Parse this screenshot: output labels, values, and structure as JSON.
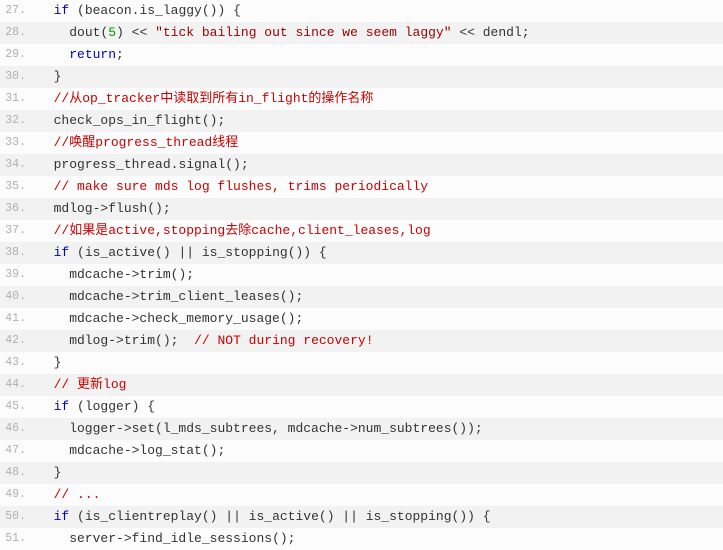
{
  "lines": [
    {
      "n": 27,
      "tokens": [
        {
          "t": "  ",
          "c": ""
        },
        {
          "t": "if",
          "c": "kw"
        },
        {
          "t": " (beacon.",
          "c": ""
        },
        {
          "t": "is_laggy",
          "c": "fn"
        },
        {
          "t": "()) {",
          "c": ""
        }
      ]
    },
    {
      "n": 28,
      "tokens": [
        {
          "t": "    ",
          "c": ""
        },
        {
          "t": "dout",
          "c": "fn"
        },
        {
          "t": "(",
          "c": ""
        },
        {
          "t": "5",
          "c": "num"
        },
        {
          "t": ") << ",
          "c": ""
        },
        {
          "t": "\"tick bailing out since we seem laggy\"",
          "c": "str"
        },
        {
          "t": " << dendl;",
          "c": ""
        }
      ]
    },
    {
      "n": 29,
      "tokens": [
        {
          "t": "    ",
          "c": ""
        },
        {
          "t": "return",
          "c": "kw"
        },
        {
          "t": ";",
          "c": ""
        }
      ]
    },
    {
      "n": 30,
      "tokens": [
        {
          "t": "  }",
          "c": ""
        }
      ]
    },
    {
      "n": 31,
      "tokens": [
        {
          "t": "  ",
          "c": ""
        },
        {
          "t": "//从op_tracker中读取到所有in_flight的操作名称",
          "c": "cmt"
        }
      ]
    },
    {
      "n": 32,
      "tokens": [
        {
          "t": "  ",
          "c": ""
        },
        {
          "t": "check_ops_in_flight",
          "c": "fn"
        },
        {
          "t": "();",
          "c": ""
        }
      ]
    },
    {
      "n": 33,
      "tokens": [
        {
          "t": "  ",
          "c": ""
        },
        {
          "t": "//唤醒progress_thread线程",
          "c": "cmt"
        }
      ]
    },
    {
      "n": 34,
      "tokens": [
        {
          "t": "  progress_thread.",
          "c": ""
        },
        {
          "t": "signal",
          "c": "fn"
        },
        {
          "t": "();",
          "c": ""
        }
      ]
    },
    {
      "n": 35,
      "tokens": [
        {
          "t": "  ",
          "c": ""
        },
        {
          "t": "// make sure mds log flushes, trims periodically",
          "c": "cmt"
        }
      ]
    },
    {
      "n": 36,
      "tokens": [
        {
          "t": "  mdlog->",
          "c": ""
        },
        {
          "t": "flush",
          "c": "fn"
        },
        {
          "t": "();",
          "c": ""
        }
      ]
    },
    {
      "n": 37,
      "tokens": [
        {
          "t": "  ",
          "c": ""
        },
        {
          "t": "//如果是active,stopping去除cache,client_leases,log",
          "c": "cmt"
        }
      ]
    },
    {
      "n": 38,
      "tokens": [
        {
          "t": "  ",
          "c": ""
        },
        {
          "t": "if",
          "c": "kw"
        },
        {
          "t": " (",
          "c": ""
        },
        {
          "t": "is_active",
          "c": "fn"
        },
        {
          "t": "() || ",
          "c": ""
        },
        {
          "t": "is_stopping",
          "c": "fn"
        },
        {
          "t": "()) {",
          "c": ""
        }
      ]
    },
    {
      "n": 39,
      "tokens": [
        {
          "t": "    mdcache->",
          "c": ""
        },
        {
          "t": "trim",
          "c": "fn"
        },
        {
          "t": "();",
          "c": ""
        }
      ]
    },
    {
      "n": 40,
      "tokens": [
        {
          "t": "    mdcache->",
          "c": ""
        },
        {
          "t": "trim_client_leases",
          "c": "fn"
        },
        {
          "t": "();",
          "c": ""
        }
      ]
    },
    {
      "n": 41,
      "tokens": [
        {
          "t": "    mdcache->",
          "c": ""
        },
        {
          "t": "check_memory_usage",
          "c": "fn"
        },
        {
          "t": "();",
          "c": ""
        }
      ]
    },
    {
      "n": 42,
      "tokens": [
        {
          "t": "    mdlog->",
          "c": ""
        },
        {
          "t": "trim",
          "c": "fn"
        },
        {
          "t": "();  ",
          "c": ""
        },
        {
          "t": "// NOT during recovery!",
          "c": "cmt"
        }
      ]
    },
    {
      "n": 43,
      "tokens": [
        {
          "t": "  }",
          "c": ""
        }
      ]
    },
    {
      "n": 44,
      "tokens": [
        {
          "t": "  ",
          "c": ""
        },
        {
          "t": "// 更新log",
          "c": "cmt"
        }
      ]
    },
    {
      "n": 45,
      "tokens": [
        {
          "t": "  ",
          "c": ""
        },
        {
          "t": "if",
          "c": "kw"
        },
        {
          "t": " (logger) {",
          "c": ""
        }
      ]
    },
    {
      "n": 46,
      "tokens": [
        {
          "t": "    logger->",
          "c": ""
        },
        {
          "t": "set",
          "c": "fn"
        },
        {
          "t": "(l_mds_subtrees, mdcache->",
          "c": ""
        },
        {
          "t": "num_subtrees",
          "c": "fn"
        },
        {
          "t": "());",
          "c": ""
        }
      ]
    },
    {
      "n": 47,
      "tokens": [
        {
          "t": "    mdcache->",
          "c": ""
        },
        {
          "t": "log_stat",
          "c": "fn"
        },
        {
          "t": "();",
          "c": ""
        }
      ]
    },
    {
      "n": 48,
      "tokens": [
        {
          "t": "  }",
          "c": ""
        }
      ]
    },
    {
      "n": 49,
      "tokens": [
        {
          "t": "  ",
          "c": ""
        },
        {
          "t": "// ...",
          "c": "cmt"
        }
      ]
    },
    {
      "n": 50,
      "tokens": [
        {
          "t": "  ",
          "c": ""
        },
        {
          "t": "if",
          "c": "kw"
        },
        {
          "t": " (",
          "c": ""
        },
        {
          "t": "is_clientreplay",
          "c": "fn"
        },
        {
          "t": "() || ",
          "c": ""
        },
        {
          "t": "is_active",
          "c": "fn"
        },
        {
          "t": "() || ",
          "c": ""
        },
        {
          "t": "is_stopping",
          "c": "fn"
        },
        {
          "t": "()) {",
          "c": ""
        }
      ]
    },
    {
      "n": 51,
      "tokens": [
        {
          "t": "    server->",
          "c": ""
        },
        {
          "t": "find_idle_sessions",
          "c": "fn"
        },
        {
          "t": "();",
          "c": ""
        }
      ]
    }
  ]
}
